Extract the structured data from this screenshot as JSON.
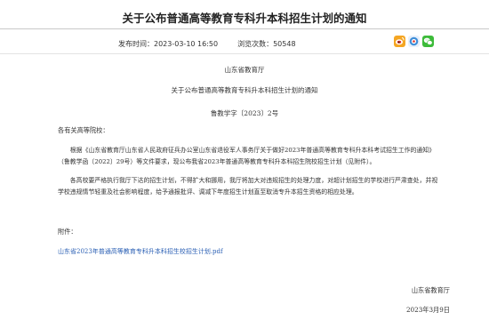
{
  "header": {
    "title": "关于公布普通高等教育专科升本科招生计划的通知",
    "publish_label": "发布时间：",
    "publish_time": "2023-03-10 16:50",
    "views_label": "浏览次数：",
    "views_count": "50548",
    "share_icons": [
      "sina-weibo-icon",
      "tencent-weibo-icon",
      "wechat-icon"
    ],
    "colors": {
      "weibo": "#f5a623",
      "tencent": "#3e8ed8",
      "wechat": "#3dbb3a"
    }
  },
  "document": {
    "issuer": "山东省教育厅",
    "title": "关于公布普通高等教育专科升本科招生计划的通知",
    "doc_number": "鲁教学字〔2023〕2号",
    "recipient": "各有关高等院校：",
    "paragraphs": [
      "根据《山东省教育厅山东省人民政府征兵办公室山东省退役军人事务厅关于做好2023年普通高等教育专科升本科考试招生工作的通知》（鲁教学函〔2022〕29号）等文件要求，现公布我省2023年普通高等教育专科升本科招生院校招生计划（见附件）。",
      "各高校要严格执行我厅下达的招生计划，不得扩大和挪用，我厅将加大对违规招生的处理力度，对超计划招生的学校进行严肃查处，并视学校违规情节轻重及社会影响程度，给予通报批评、调减下年度招生计划直至取消专升本招生资格的相应处理。"
    ],
    "attachment_label": "附件：",
    "attachment_link": "山东省2023年普通高等教育专科升本科招生校招生计划.pdf",
    "signature": "山东省教育厅",
    "date": "2023年3月9日"
  }
}
